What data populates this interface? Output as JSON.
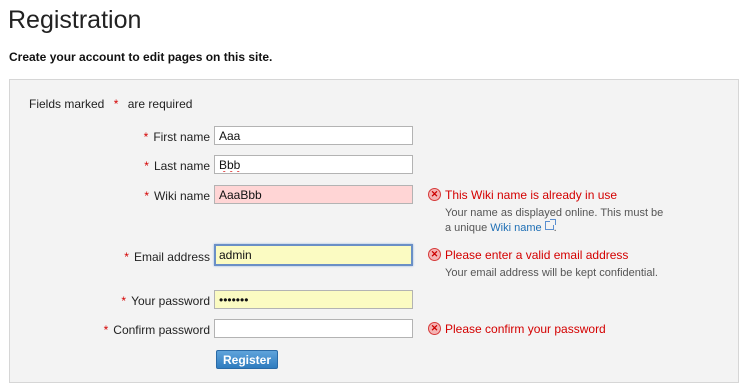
{
  "page": {
    "title": "Registration",
    "intro": "Create your account to edit pages on this site."
  },
  "form": {
    "required_note_prefix": "Fields marked",
    "required_marker": "*",
    "required_note_suffix": "are required",
    "first_name": {
      "label": "First name",
      "value": "Aaa"
    },
    "last_name": {
      "label": "Last name",
      "value": "Bbb"
    },
    "wiki_name": {
      "label": "Wiki name",
      "value": "AaaBbb",
      "error": "This Wiki name is already in use",
      "hint_line1": "Your name as displayed online. This must be",
      "hint_prefix": "a unique",
      "hint_link": "Wiki name",
      "hint_suffix": "."
    },
    "email": {
      "label": "Email address",
      "value": "admin",
      "error": "Please enter a valid email address",
      "hint": "Your email address will be kept confidential."
    },
    "password": {
      "label": "Your password",
      "value": "•••••••"
    },
    "confirm_password": {
      "label": "Confirm password",
      "value": "",
      "error": "Please confirm your password"
    },
    "submit_label": "Register"
  },
  "icons": {
    "error": "error-x-icon",
    "external_link": "external-link-icon"
  },
  "colors": {
    "error_text": "#d40000",
    "error_field_bg": "#ffd5d5",
    "warn_field_bg": "#fbfbc2",
    "link": "#1e6fb5",
    "button": "#2f7cbf"
  }
}
